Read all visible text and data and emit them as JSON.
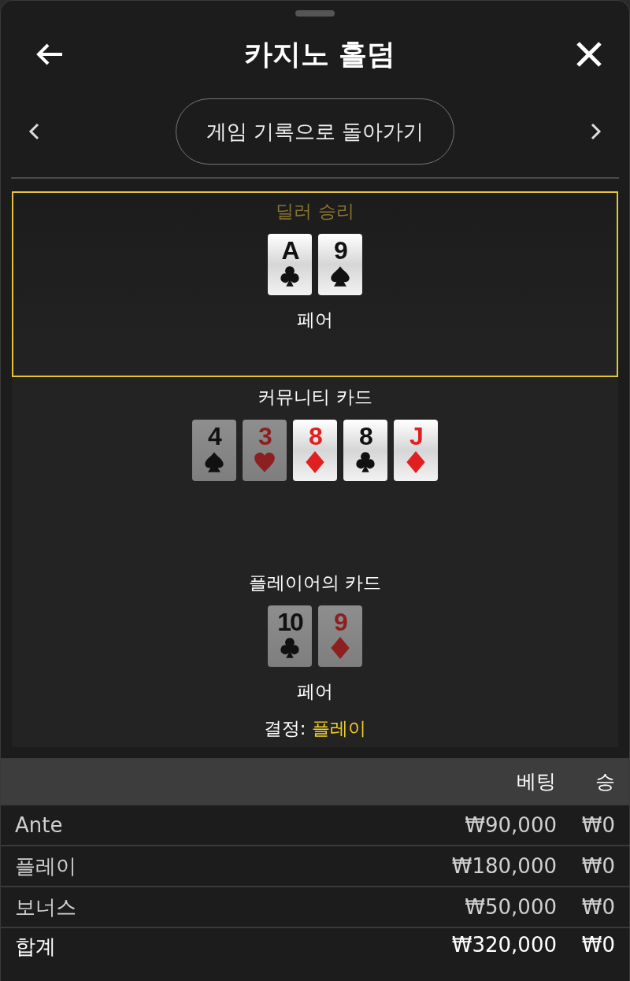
{
  "header": {
    "title": "카지노 홀덤"
  },
  "nav": {
    "back_to_history": "게임 기록으로 돌아가기"
  },
  "sections": [
    {
      "title": "딜러 승리",
      "winner": true,
      "cards": [
        {
          "rank": "A",
          "kind": "clubs",
          "dimmed": false
        },
        {
          "rank": "9",
          "kind": "spades",
          "dimmed": false
        }
      ],
      "hand": "페어"
    },
    {
      "title": "커뮤니티 카드",
      "winner": false,
      "cards": [
        {
          "rank": "4",
          "kind": "spades",
          "dimmed": true
        },
        {
          "rank": "3",
          "kind": "hearts",
          "dimmed": true
        },
        {
          "rank": "8",
          "kind": "diamonds",
          "dimmed": false
        },
        {
          "rank": "8",
          "kind": "clubs",
          "dimmed": false
        },
        {
          "rank": "J",
          "kind": "diamonds",
          "dimmed": false
        }
      ]
    },
    {
      "title": "플레이어의 카드",
      "winner": false,
      "cards": [
        {
          "rank": "10",
          "kind": "clubs",
          "dimmed": true
        },
        {
          "rank": "9",
          "kind": "diamonds",
          "dimmed": true
        }
      ],
      "hand": "페어",
      "decision": {
        "label": "결정:",
        "value": "플레이"
      }
    }
  ],
  "table": {
    "columns": [
      "베팅",
      "승"
    ],
    "rows": [
      {
        "kind": "bet",
        "name": "Ante",
        "bet": "₩90,000",
        "win": "₩0"
      },
      {
        "kind": "bet",
        "name": "플레이",
        "bet": "₩180,000",
        "win": "₩0"
      },
      {
        "kind": "bet",
        "name": "보너스",
        "bet": "₩50,000",
        "win": "₩0"
      },
      {
        "kind": "total",
        "name": "합계",
        "bet": "₩320,000",
        "win": "₩0"
      }
    ]
  }
}
